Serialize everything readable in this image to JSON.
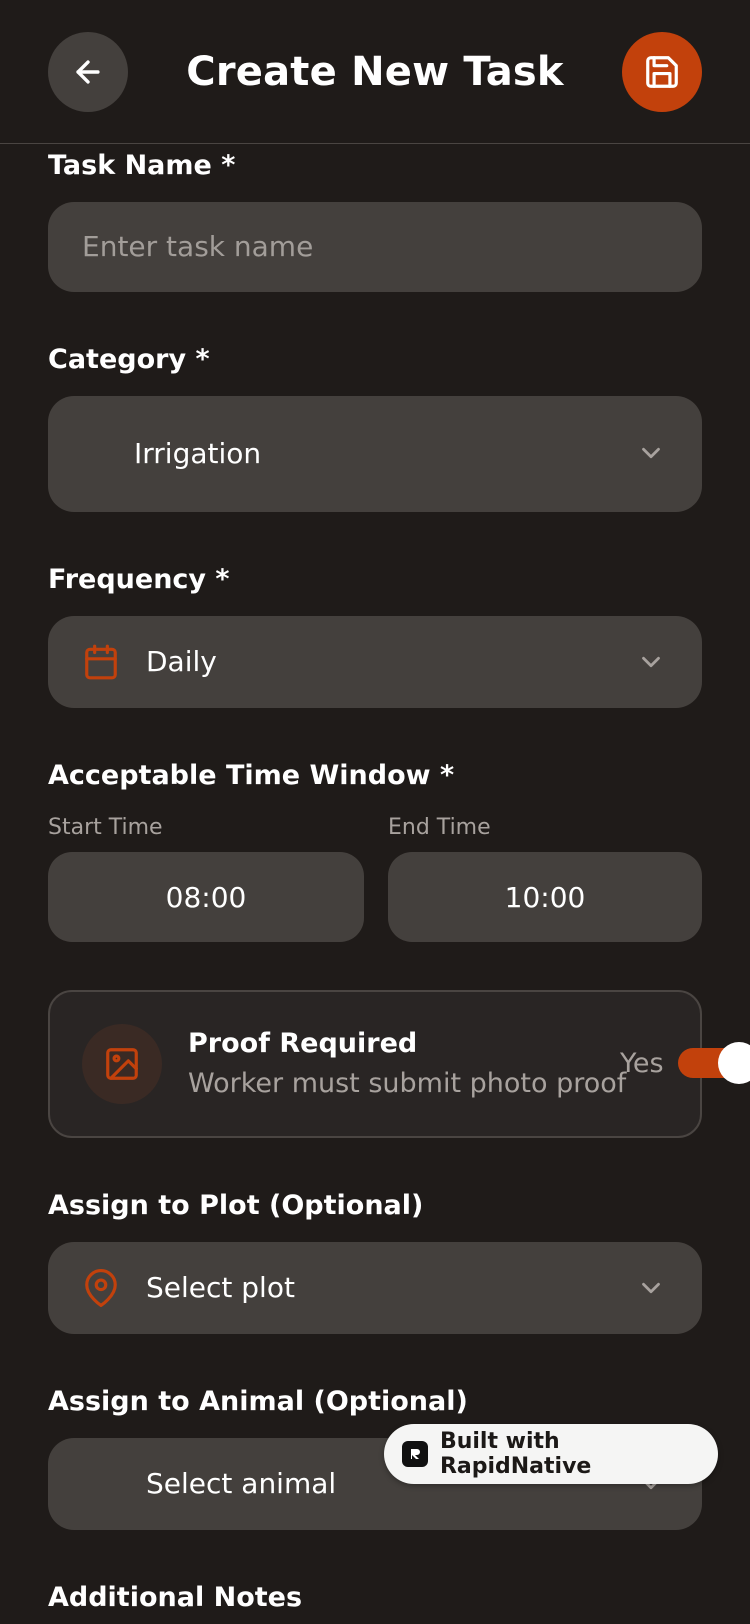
{
  "header": {
    "title": "Create New Task"
  },
  "task_name": {
    "label": "Task Name *",
    "placeholder": "Enter task name",
    "value": ""
  },
  "category": {
    "label": "Category *",
    "value": "Irrigation"
  },
  "frequency": {
    "label": "Frequency *",
    "value": "Daily"
  },
  "time_window": {
    "label": "Acceptable Time Window *",
    "start_label": "Start Time",
    "start_value": "08:00",
    "end_label": "End Time",
    "end_value": "10:00"
  },
  "proof": {
    "title": "Proof Required",
    "subtitle": "Worker must submit photo proof",
    "state_label": "Yes",
    "enabled": true
  },
  "plot": {
    "label": "Assign to Plot (Optional)",
    "value": "Select plot"
  },
  "animal": {
    "label": "Assign to Animal (Optional)",
    "value": "Select animal"
  },
  "notes": {
    "label": "Additional Notes"
  },
  "badge": {
    "text": "Built with RapidNative"
  },
  "colors": {
    "accent": "#c2410c",
    "background": "#1f1b19",
    "field": "#44403d"
  }
}
